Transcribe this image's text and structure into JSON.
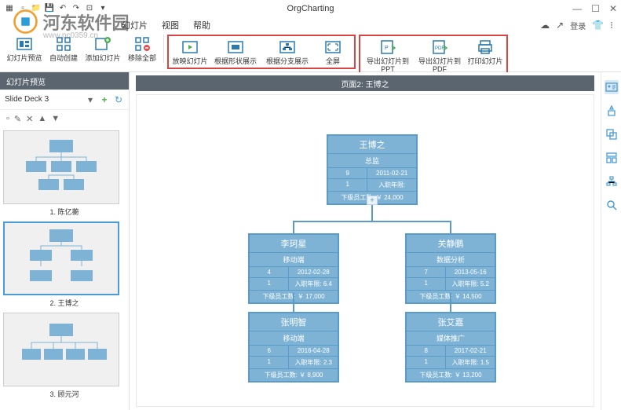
{
  "app_title": "OrgCharting",
  "watermark": {
    "text": "河东软件园",
    "sub": "www.pc0359.cn"
  },
  "menubar": {
    "items": [
      "幻灯片",
      "视图",
      "帮助"
    ],
    "login": "登录"
  },
  "ribbon": {
    "g1": [
      {
        "label": "幻灯片预览",
        "icon": "preview-icon"
      },
      {
        "label": "自动创建",
        "icon": "auto-icon"
      },
      {
        "label": "添加幻灯片",
        "icon": "add-slide-icon"
      },
      {
        "label": "移除全部",
        "icon": "remove-all-icon"
      }
    ],
    "g2": [
      {
        "label": "放映幻灯片",
        "icon": "play-icon"
      },
      {
        "label": "根据形状展示",
        "icon": "shape-show-icon"
      },
      {
        "label": "根据分支展示",
        "icon": "branch-show-icon"
      },
      {
        "label": "全屏",
        "icon": "fullscreen-icon"
      }
    ],
    "g3": [
      {
        "label": "导出幻灯片到PPT",
        "icon": "export-ppt-icon"
      },
      {
        "label": "导出幻灯片到PDF",
        "icon": "export-pdf-icon"
      },
      {
        "label": "打印幻灯片",
        "icon": "print-icon"
      }
    ]
  },
  "sidepanel": {
    "header": "幻灯片预览",
    "deck_label": "Slide Deck 3",
    "slides": [
      {
        "label": "1. 陈亿蘅"
      },
      {
        "label": "2. 王博之"
      },
      {
        "label": "3. 顾元河"
      }
    ]
  },
  "page_header": "页面2: 王博之",
  "org": {
    "root": {
      "title": "王博之",
      "sub": "总监",
      "rows": [
        {
          "l": "9",
          "r": "2011-02-21"
        },
        {
          "l": "1",
          "r": "入职年限:"
        },
        {
          "full": "下级员工数: ￥ 24,000"
        }
      ]
    },
    "c1": {
      "title": "李珂星",
      "sub": "移动端",
      "rows": [
        {
          "l": "4",
          "r": "2012-02-28"
        },
        {
          "l": "1",
          "r": "入职年限: 6.4"
        },
        {
          "full": "下级员工数: ￥ 17,000"
        }
      ]
    },
    "c2": {
      "title": "关静鹏",
      "sub": "数据分析",
      "rows": [
        {
          "l": "7",
          "r": "2013-05-16"
        },
        {
          "l": "1",
          "r": "入职年限: 5.2"
        },
        {
          "full": "下级员工数: ￥ 14,500"
        }
      ]
    },
    "c3": {
      "title": "张明智",
      "sub": "移动端",
      "rows": [
        {
          "l": "6",
          "r": "2016-04-28"
        },
        {
          "l": "1",
          "r": "入职年限: 2.3"
        },
        {
          "full": "下级员工数: ￥ 8,900"
        }
      ]
    },
    "c4": {
      "title": "张艾嘉",
      "sub": "媒体推广",
      "rows": [
        {
          "l": "8",
          "r": "2017-02-21"
        },
        {
          "l": "1",
          "r": "入职年限: 1.5"
        },
        {
          "full": "下级员工数: ￥ 13,200"
        }
      ]
    }
  }
}
